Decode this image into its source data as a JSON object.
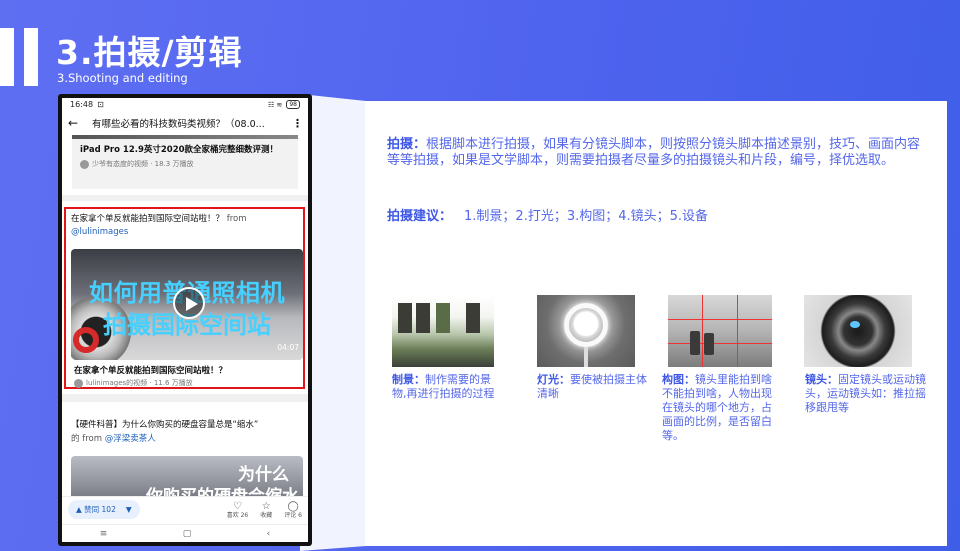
{
  "header": {
    "title": "3.拍摄/剪辑",
    "subtitle": "3.Shooting and editing"
  },
  "phone": {
    "status_time": "16:48",
    "status_icons": "⊡",
    "status_right": "☷ ≋",
    "battery": "98",
    "nav_title": "有哪些必看的科技数码类视频？（08.0...",
    "item1_title": "iPad Pro 12.9英寸2020款全家桶完整细数评测！",
    "item1_meta": "少爷有态度的视频 · 18.3 万播放",
    "highlight_title": "在家拿个单反就能拍到国际空间站啦！？",
    "highlight_from": " from ",
    "highlight_user": "@lulinimages",
    "video_line1": "如何用普通照相机",
    "video_line2": "拍摄国际空间站",
    "video_duration": "04:07",
    "video_caption": "在家拿个单反就能拍到国际空间站啦！？",
    "video_meta": "lulinimages的视频 · 11.6 万播放",
    "item3_title": "【硬件科普】为什么你购买的硬盘容量总是“缩水”",
    "item3_from": "的 from ",
    "item3_user": "@浮梁卖茶人",
    "video2_line1": "为什么",
    "video2_line2": "你购买的硬盘会缩水",
    "like_label": "▲ 赞同 102",
    "dislike_label": "▼",
    "action_like_count": "喜欢 26",
    "action_fav": "收藏",
    "action_comment": "评论 6",
    "sys_menu": "≡",
    "sys_home": "▢",
    "sys_back": "‹"
  },
  "content": {
    "para_label": "拍摄：",
    "para_text": "根据脚本进行拍摄，如果有分镜头脚本，则按照分镜头脚本描述景别，技巧、画面内容等等拍摄，如果是文学脚本，则需要拍摄者尽量多的拍摄镜头和片段，编号，择优选取。",
    "suggest_label": "拍摄建议：",
    "suggest_text": "1.制景；2.打光；3.构图；4.镜头；5.设备",
    "items": [
      {
        "label": "制景：",
        "text": "制作需要的景物,再进行拍摄的过程"
      },
      {
        "label": "灯光：",
        "text": "要使被拍摄主体清晰"
      },
      {
        "label": "构图：",
        "text": "镜头里能拍到啥不能拍到啥，人物出现在镜头的哪个地方，占画面的比例，是否留白等。"
      },
      {
        "label": "镜头：",
        "text": "固定镜头或运动镜头，运动镜头如：推拉摇移跟甩等"
      }
    ]
  },
  "colors": {
    "background": "#4e63ee",
    "accent_text": "#5467ea",
    "highlight_border": "#e0141b"
  }
}
